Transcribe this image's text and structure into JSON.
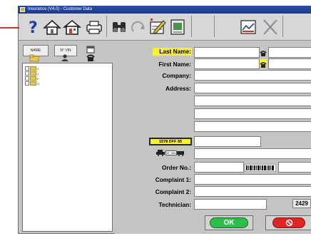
{
  "window": {
    "title": "Insurance (V4.0) - Customer Data"
  },
  "toolbar": {
    "icons": [
      "help-icon",
      "home-icon",
      "house-icon",
      "print-icon",
      "binoculars-icon",
      "undo-arc-icon",
      "edit-note-icon",
      "notebook-icon",
      "document-chart-icon",
      "close-x-icon"
    ]
  },
  "left_pane": {
    "tabs": [
      {
        "label": "NAME"
      },
      {
        "label": "N° VIN"
      }
    ],
    "tree_items": [
      {
        "label": "0"
      },
      {
        "label": "2"
      },
      {
        "label": "P"
      },
      {
        "label": "G"
      }
    ]
  },
  "form": {
    "last_name_label": "Last Name:",
    "first_name_label": "First Name:",
    "company_label": "Company:",
    "address_label": "Address:",
    "plate_badge": "1578 DFF 95",
    "vin_badge": "N° VIN",
    "order_label": "Order No.:",
    "complaint1_label": "Complaint 1:",
    "complaint2_label": "Complaint 2:",
    "technician_label": "Technician:",
    "technician_code": "2429",
    "ok_label": "OK"
  },
  "colors": {
    "highlight": "#f6f230",
    "ok_green": "#2cc04a",
    "cancel_red": "#e02424"
  }
}
